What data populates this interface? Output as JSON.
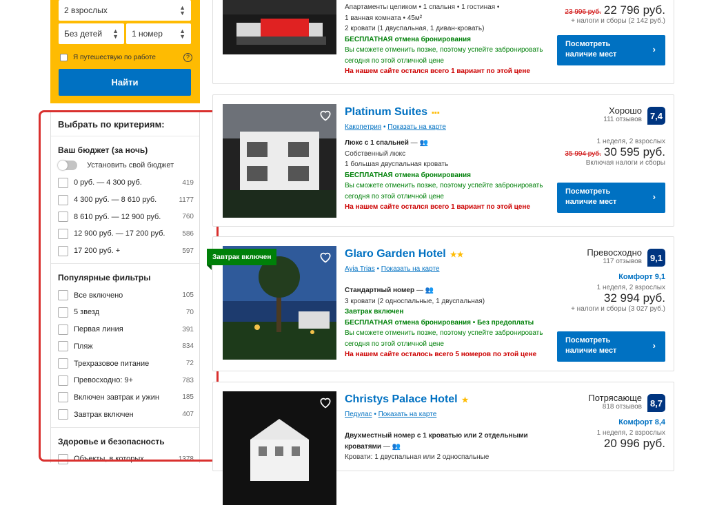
{
  "search": {
    "guests": "2 взрослых",
    "children": "Без детей",
    "rooms": "1 номер",
    "work_trip": "Я путешествую по работе",
    "help": "?",
    "submit": "Найти"
  },
  "filters": {
    "title": "Выбрать по критериям:",
    "budget": {
      "title": "Ваш бюджет (за ночь)",
      "toggle_label": "Установить свой бюджет",
      "options": [
        {
          "label": "0 руб. — 4 300 руб.",
          "count": "419"
        },
        {
          "label": "4 300 руб. — 8 610 руб.",
          "count": "1177"
        },
        {
          "label": "8 610 руб. — 12 900 руб.",
          "count": "760"
        },
        {
          "label": "12 900 руб. — 17 200 руб.",
          "count": "586"
        },
        {
          "label": "17 200 руб. +",
          "count": "597"
        }
      ]
    },
    "popular": {
      "title": "Популярные фильтры",
      "options": [
        {
          "label": "Все включено",
          "count": "105"
        },
        {
          "label": "5 звезд",
          "count": "70"
        },
        {
          "label": "Первая линия",
          "count": "391"
        },
        {
          "label": "Пляж",
          "count": "834"
        },
        {
          "label": "Трехразовое питание",
          "count": "72"
        },
        {
          "label": "Превосходно: 9+",
          "count": "783"
        },
        {
          "label": "Включен завтрак и ужин",
          "count": "185"
        },
        {
          "label": "Завтрак включен",
          "count": "407"
        }
      ]
    },
    "health": {
      "title": "Здоровье и безопасность",
      "options": [
        {
          "label": "Объекты, в которых",
          "count": "1378"
        }
      ]
    }
  },
  "hotels": [
    {
      "lines": [
        "Апартаменты целиком • 1 спальня • 1 гостиная •",
        "1 ванная комната • 45м²",
        "2 кровати (1 двуспальная, 1 диван-кровать)"
      ],
      "free_cancel": "БЕСПЛАТНАЯ отмена бронирования",
      "cancel_note": "Вы сможете отменить позже, поэтому успейте забронировать сегодня по этой отличной цене",
      "scarcity": "На нашем сайте остался всего 1 вариант по этой цене",
      "old_price": "23 996 руб.",
      "price": "22 796 руб.",
      "taxes": "+ налоги и сборы (2 142 руб.)",
      "cta": "Посмотреть наличие мест"
    },
    {
      "name": "Platinum Suites",
      "stars": "▪▪▪",
      "location": "Какопетрия",
      "map_link": "Показать на карте",
      "room": "Люкс с 1 спальней",
      "room_sub": "Собственный люкс",
      "beds": "1 большая двуспальная кровать",
      "free_cancel": "БЕСПЛАТНАЯ отмена бронирования",
      "cancel_note": "Вы сможете отменить позже, поэтому успейте забронировать сегодня по этой отличной цене",
      "scarcity": "На нашем сайте остался всего 1 вариант по этой цене",
      "rating_word": "Хорошо",
      "reviews": "111 отзывов",
      "score": "7,4",
      "stay": "1 неделя, 2 взрослых",
      "old_price": "35 994 руб.",
      "price": "30 595 руб.",
      "taxes": "Включая налоги и сборы",
      "cta": "Посмотреть наличие мест"
    },
    {
      "name": "Glaro Garden Hotel",
      "stars": "★★",
      "ribbon": "Завтрак включен",
      "location": "Ayia Trias",
      "map_link": "Показать на карте",
      "room": "Стандартный номер",
      "beds": "3 кровати (2 односпальные, 1 двуспальная)",
      "breakfast": "Завтрак включен",
      "free_cancel": "БЕСПЛАТНАЯ отмена бронирования • Без предоплаты",
      "cancel_note": "Вы сможете отменить позже, поэтому успейте забронировать сегодня по этой отличной цене",
      "scarcity": "На нашем сайте осталось всего 5 номеров по этой цене",
      "rating_word": "Превосходно",
      "reviews": "117 отзывов",
      "score": "9,1",
      "comfort": "Комфорт 9,1",
      "stay": "1 неделя, 2 взрослых",
      "price": "32 994 руб.",
      "taxes": "+ налоги и сборы (3 027 руб.)",
      "cta": "Посмотреть наличие мест"
    },
    {
      "name": "Christys Palace Hotel",
      "stars": "★",
      "location": "Педулас",
      "map_link": "Показать на карте",
      "room": "Двухместный номер с 1 кроватью или 2 отдельными кроватями",
      "beds": "Кровати: 1 двуспальная или 2 односпальные",
      "rating_word": "Потрясающе",
      "reviews": "818 отзывов",
      "score": "8,7",
      "comfort": "Комфорт 8,4",
      "stay": "1 неделя, 2 взрослых",
      "price": "20 996 руб."
    }
  ]
}
